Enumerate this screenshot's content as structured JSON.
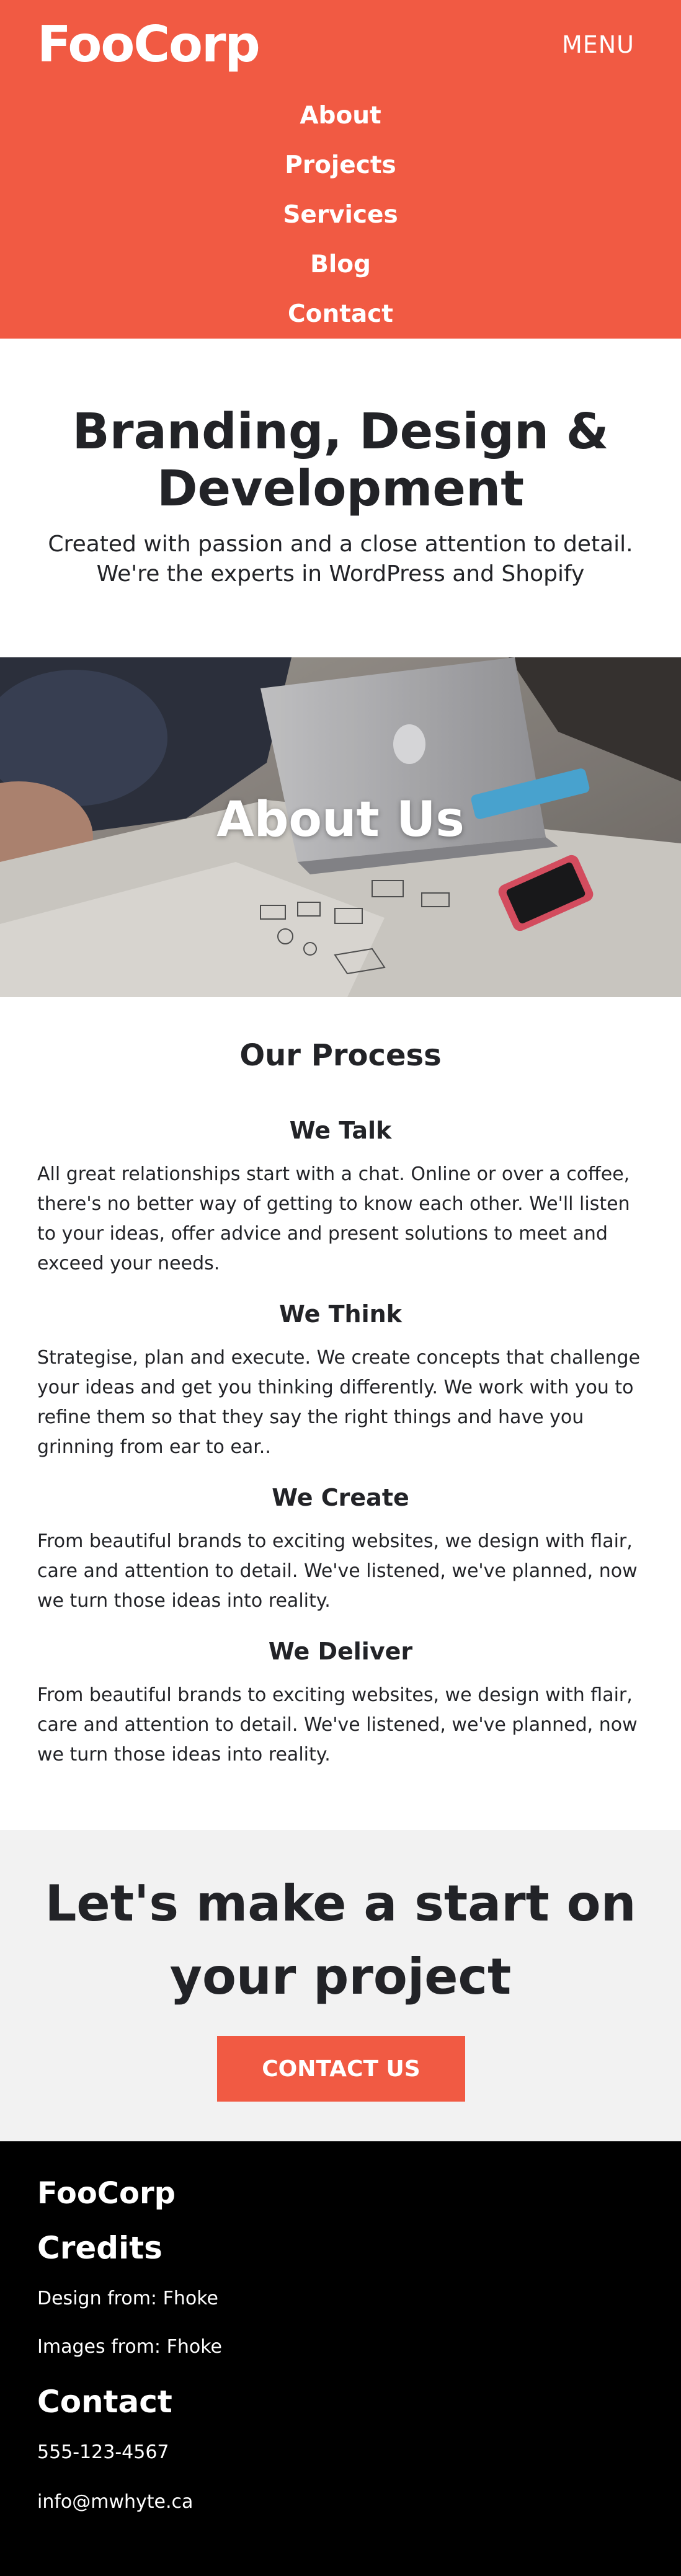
{
  "header": {
    "logo": "FooCorp",
    "menu_label": "MENU",
    "nav": [
      {
        "label": "About"
      },
      {
        "label": "Projects"
      },
      {
        "label": "Services"
      },
      {
        "label": "Blog"
      },
      {
        "label": "Contact"
      }
    ]
  },
  "hero": {
    "title": "Branding, Design & Development",
    "subtitle": "Created with passion and a close attention to detail. We're the experts in WordPress and Shopify"
  },
  "about_banner": {
    "title": "About Us"
  },
  "process": {
    "title": "Our Process",
    "steps": [
      {
        "title": "We Talk",
        "text": "All great relationships start with a chat. Online or over a coffee, there's no better way of getting to know each other. We'll listen to your ideas, offer advice and present solutions to meet and exceed your needs."
      },
      {
        "title": "We Think",
        "text": "Strategise, plan and execute. We create concepts that challenge your ideas and get you thinking differently. We work with you to refine them so that they say the right things and have you grinning from ear to ear.."
      },
      {
        "title": "We Create",
        "text": "From beautiful brands to exciting websites, we design with flair, care and attention to detail. We've listened, we've planned, now we turn those ideas into reality."
      },
      {
        "title": "We Deliver",
        "text": "From beautiful brands to exciting websites, we design with flair, care and attention to detail. We've listened, we've planned, now we turn those ideas into reality."
      }
    ]
  },
  "cta": {
    "title": "Let's make a start on your project",
    "button_label": "CONTACT US"
  },
  "footer": {
    "brand": "FooCorp",
    "credits_heading": "Credits",
    "design_credit": "Design from: Fhoke",
    "images_credit": "Images from: Fhoke",
    "contact_heading": "Contact",
    "phone": "555-123-4567",
    "email": "info@mwhyte.ca"
  },
  "colors": {
    "brand": "#f15a43",
    "text": "#222327",
    "cta_background": "#f2f2f2",
    "footer_background": "#000000"
  }
}
